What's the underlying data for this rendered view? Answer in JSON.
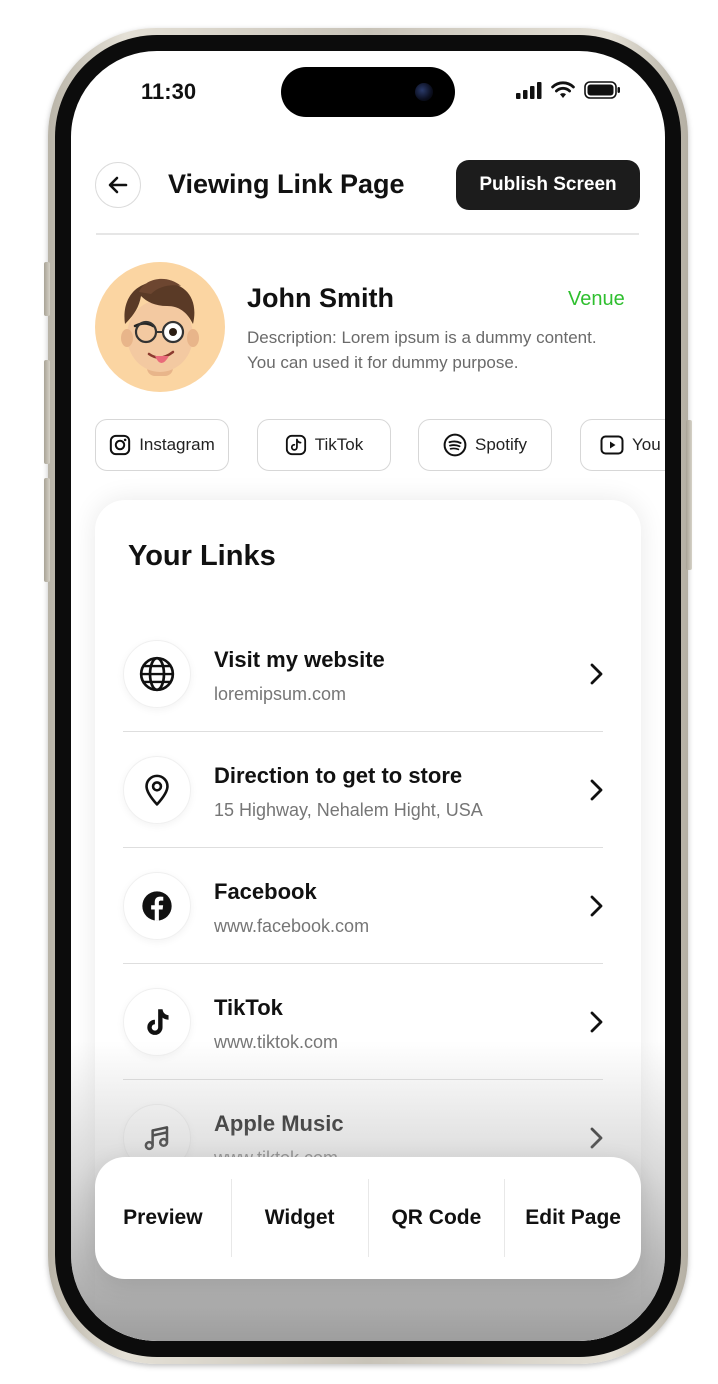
{
  "status_bar": {
    "time": "11:30"
  },
  "header": {
    "title": "Viewing Link Page",
    "publish_label": "Publish Screen"
  },
  "profile": {
    "name": "John Smith",
    "tag": "Venue",
    "description": "Description: Lorem ipsum is a dummy content. You can used it for dummy purpose."
  },
  "social_chips": [
    {
      "label": "Instagram",
      "icon": "instagram-icon"
    },
    {
      "label": "TikTok",
      "icon": "tiktok-icon"
    },
    {
      "label": "Spotify",
      "icon": "spotify-icon"
    },
    {
      "label": "You",
      "icon": "youtube-icon"
    }
  ],
  "links_section": {
    "title": "Your Links",
    "items": [
      {
        "title": "Visit my website",
        "subtitle": "loremipsum.com",
        "icon": "globe-icon"
      },
      {
        "title": "Direction to get to store",
        "subtitle": "15 Highway, Nehalem Hight, USA",
        "icon": "location-pin-icon"
      },
      {
        "title": "Facebook",
        "subtitle": "www.facebook.com",
        "icon": "facebook-icon"
      },
      {
        "title": "TikTok",
        "subtitle": "www.tiktok.com",
        "icon": "tiktok-icon"
      },
      {
        "title": "Apple Music",
        "subtitle": "www.tiktok.com",
        "icon": "music-note-icon"
      }
    ]
  },
  "bottom_tabs": [
    {
      "label": "Preview"
    },
    {
      "label": "Widget"
    },
    {
      "label": "QR Code"
    },
    {
      "label": "Edit Page"
    }
  ],
  "colors": {
    "accent_green": "#2fbf2f",
    "button_dark": "#1c1c1c",
    "avatar_bg": "#fbd5a2"
  }
}
